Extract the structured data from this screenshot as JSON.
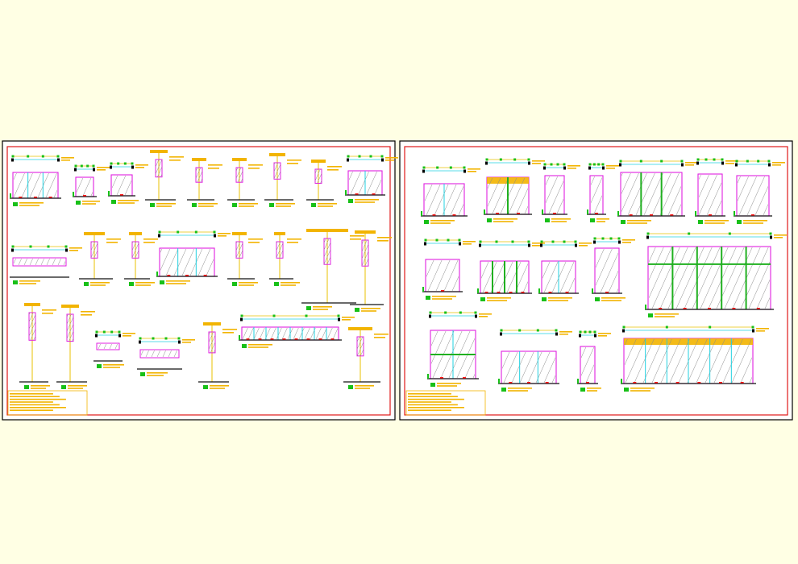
{
  "colors": {
    "background": "#ffffe4",
    "sheet": "#ffffff",
    "sheet_frame": "#000000",
    "sheet_border": "#e01818",
    "annotation_yellow": "#f2b400",
    "leader_yellow": "#e8c200",
    "tag_green": "#18c018",
    "tag_text_green": "#00a000",
    "glass_magenta": "#e020e0",
    "frame_cyan": "#20d0e0",
    "mullion_green": "#20b020",
    "floor_black": "#111111",
    "hatch_gray": "#8a8a8a",
    "marker_red": "#ff1a1a"
  },
  "sheets": [
    {
      "name": "drawing-sheet-left",
      "detail_count": 31
    },
    {
      "name": "drawing-sheet-right",
      "detail_count": 20
    }
  ]
}
